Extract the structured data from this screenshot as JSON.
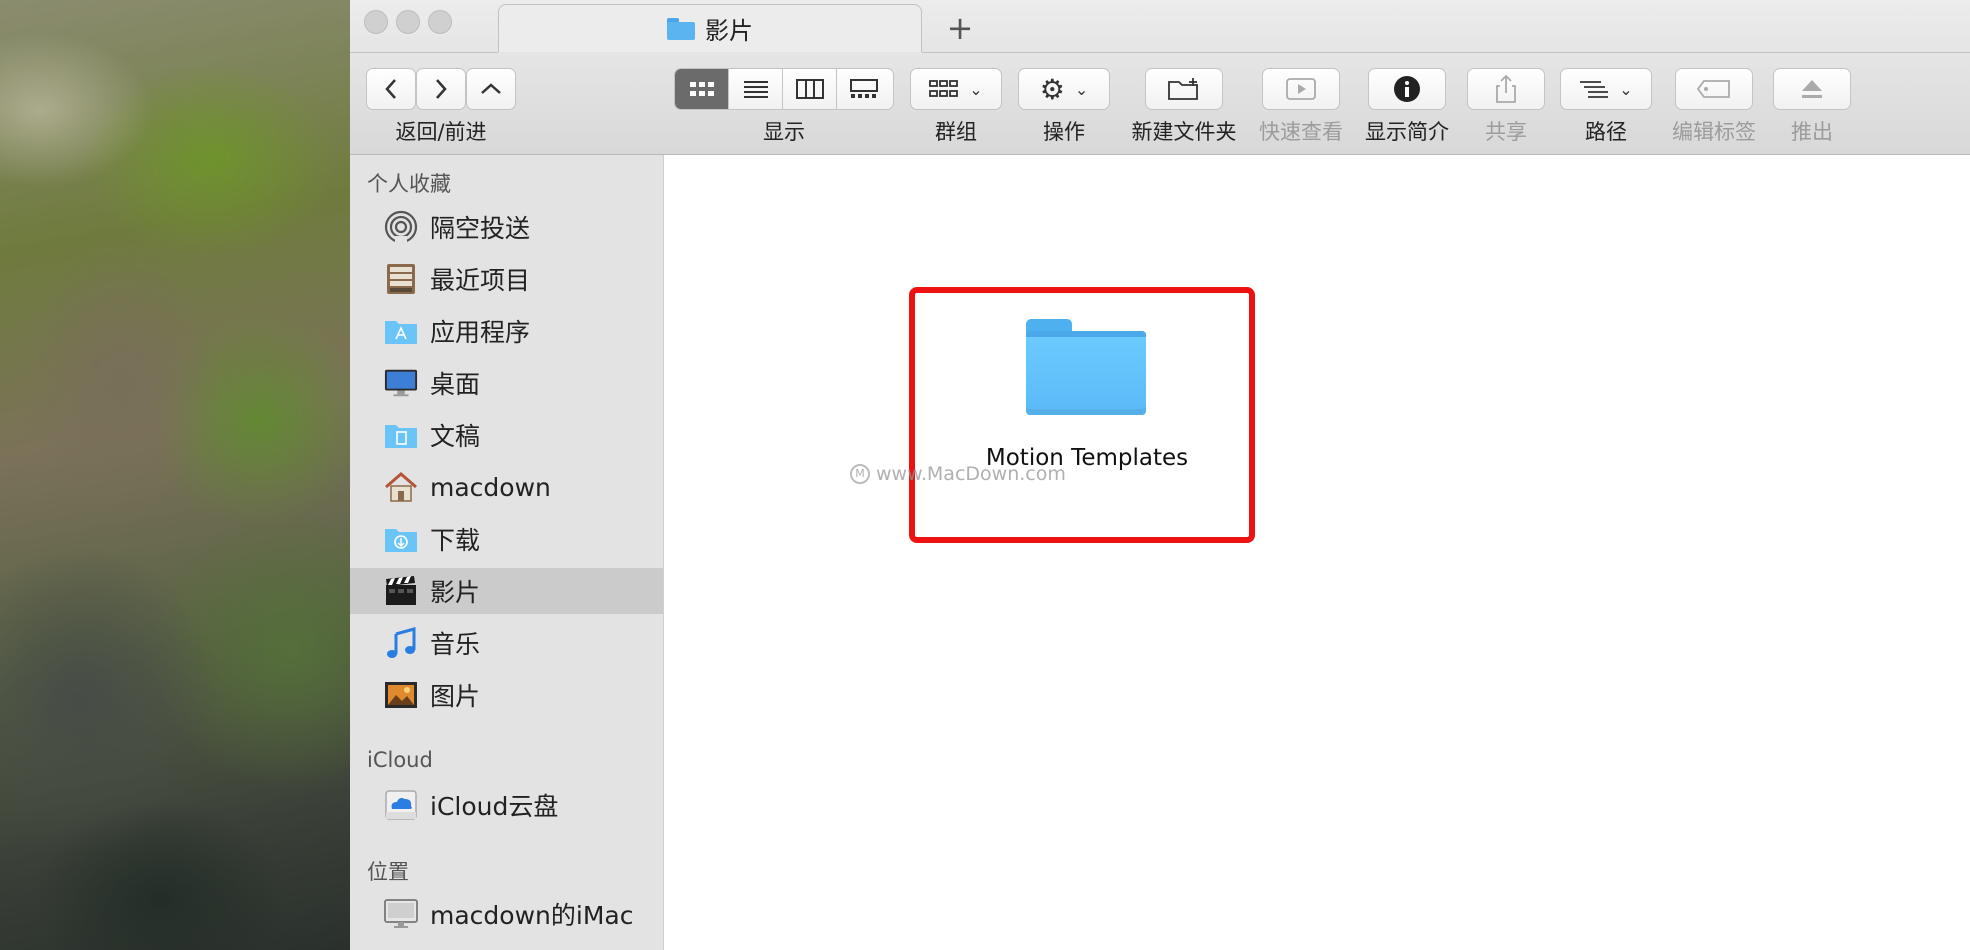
{
  "window": {
    "tab_title": "影片",
    "new_tab_symbol": "+"
  },
  "toolbar": {
    "nav_label": "返回/前进",
    "view_label": "显示",
    "group_label": "群组",
    "action_label": "操作",
    "new_folder_label": "新建文件夹",
    "quicklook_label": "快速查看",
    "info_label": "显示简介",
    "share_label": "共享",
    "path_label": "路径",
    "tags_label": "编辑标签",
    "eject_label": "推出"
  },
  "sidebar": {
    "favorites_title": "个人收藏",
    "items": [
      {
        "label": "隔空投送",
        "icon": "airdrop-icon"
      },
      {
        "label": "最近项目",
        "icon": "recents-icon"
      },
      {
        "label": "应用程序",
        "icon": "applications-icon"
      },
      {
        "label": "桌面",
        "icon": "desktop-icon"
      },
      {
        "label": "文稿",
        "icon": "documents-icon"
      },
      {
        "label": "macdown",
        "icon": "home-icon"
      },
      {
        "label": "下载",
        "icon": "downloads-icon"
      },
      {
        "label": "影片",
        "icon": "movies-icon",
        "selected": true
      },
      {
        "label": "音乐",
        "icon": "music-icon"
      },
      {
        "label": "图片",
        "icon": "pictures-icon"
      }
    ],
    "icloud_title": "iCloud",
    "icloud_items": [
      {
        "label": "iCloud云盘",
        "icon": "icloud-drive-icon"
      }
    ],
    "locations_title": "位置",
    "location_items": [
      {
        "label": "macdown的iMac",
        "icon": "imac-icon"
      }
    ]
  },
  "content": {
    "folder_name": "Motion Templates",
    "watermark": "www.MacDown.com",
    "highlight_color": "#ee1111"
  }
}
